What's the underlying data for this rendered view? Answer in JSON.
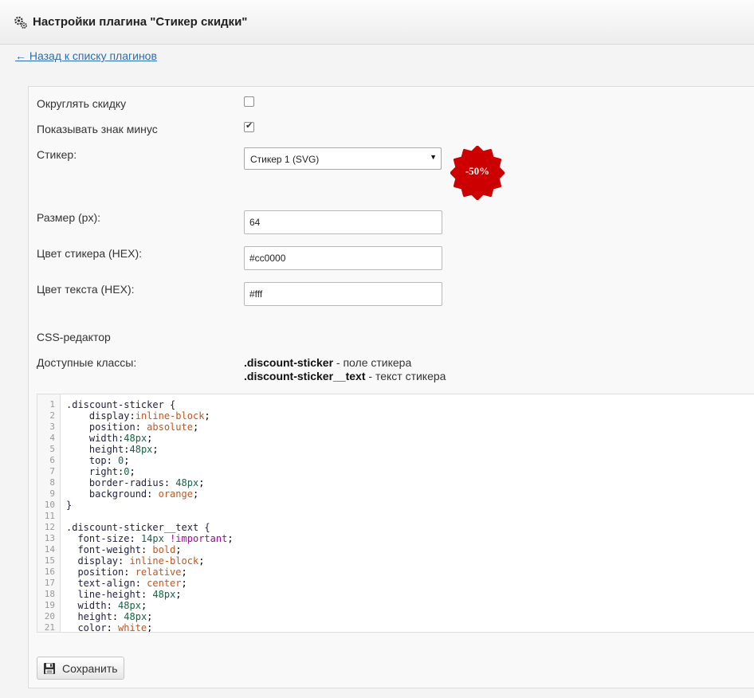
{
  "header": {
    "title": "Настройки плагина \"Стикер скидки\"",
    "icon": "gears-icon"
  },
  "back_link": "← Назад к списку плагинов",
  "form": {
    "round_discount": {
      "label": "Округлять скидку",
      "checked": false
    },
    "show_minus": {
      "label": "Показывать знак минус",
      "checked": true
    },
    "sticker": {
      "label": "Стикер:",
      "selected": "Стикер 1 (SVG)",
      "preview_text": "-50%",
      "preview_color": "#cc0000"
    },
    "size": {
      "label": "Размер (px):",
      "value": "64"
    },
    "sticker_color": {
      "label": "Цвет стикера (HEX):",
      "value": "#cc0000"
    },
    "text_color": {
      "label": "Цвет текста (HEX):",
      "value": "#fff"
    },
    "css_editor_label": "CSS-редактор",
    "available_classes_label": "Доступные классы:",
    "classes": [
      {
        "name": ".discount-sticker",
        "desc": " - поле стикера"
      },
      {
        "name": ".discount-sticker__text",
        "desc": " - текст стикера"
      }
    ],
    "code_lines": [
      ".discount-sticker {",
      "    display:inline-block;",
      "    position: absolute;",
      "    width:48px;",
      "    height:48px;",
      "    top: 0;",
      "    right:0;",
      "    border-radius: 48px;",
      "    background: orange;",
      "}",
      "",
      ".discount-sticker__text {",
      "  font-size: 14px !important;",
      "  font-weight: bold;",
      "  display: inline-block;",
      "  position: relative;",
      "  text-align: center;",
      "  line-height: 48px;",
      "  width: 48px;",
      "  height: 48px;",
      "  color: white;"
    ],
    "save_button": "Сохранить"
  }
}
